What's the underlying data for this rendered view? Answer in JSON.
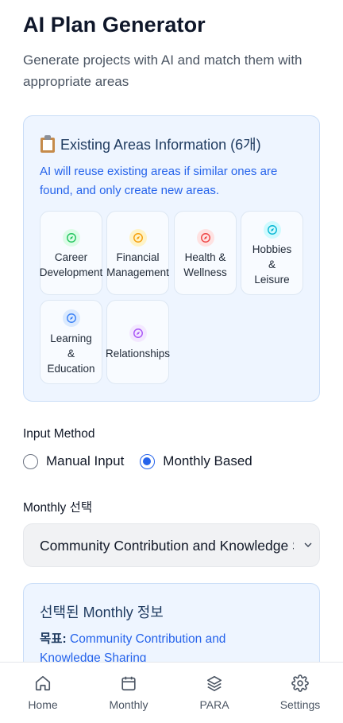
{
  "header": {
    "title": "AI Plan Generator",
    "subtitle": "Generate projects with AI and match them with appropriate areas"
  },
  "areas_card": {
    "title": "Existing Areas Information (6개)",
    "description": "AI will reuse existing areas if similar ones are found, and only create new areas.",
    "icon": "clipboard-icon",
    "areas": [
      {
        "line1": "Career",
        "line2": "Development",
        "line3": "",
        "icon": "compass-icon",
        "color": "#22c55e",
        "bg": "#dcfce7"
      },
      {
        "line1": "Financial",
        "line2": "Management",
        "line3": "",
        "icon": "compass-icon",
        "color": "#f59e0b",
        "bg": "#fef3c7"
      },
      {
        "line1": "Health &",
        "line2": "Wellness",
        "line3": "",
        "icon": "compass-icon",
        "color": "#ef4444",
        "bg": "#fee2e2"
      },
      {
        "line1": "Hobbies",
        "line2": "&",
        "line3": "Leisure",
        "icon": "compass-icon",
        "color": "#06b6d4",
        "bg": "#cffafe"
      },
      {
        "line1": "Learning",
        "line2": "&",
        "line3": "Education",
        "icon": "compass-icon",
        "color": "#3b82f6",
        "bg": "#dbeafe"
      },
      {
        "line1": "Relationships",
        "line2": "",
        "line3": "",
        "icon": "compass-icon",
        "color": "#a855f7",
        "bg": "#f3e8ff"
      }
    ]
  },
  "input_method": {
    "label": "Input Method",
    "options": [
      {
        "label": "Manual Input",
        "selected": false
      },
      {
        "label": "Monthly Based",
        "selected": true
      }
    ]
  },
  "monthly_select": {
    "label": "Monthly 선택",
    "value": "Community Contribution and Knowledge Sharing"
  },
  "selected_monthly": {
    "title": "선택된 Monthly 정보",
    "goal_label": "목표:",
    "goal_value": "Community Contribution and Knowledge Sharing"
  },
  "bottom_nav": [
    {
      "label": "Home",
      "icon": "home-icon"
    },
    {
      "label": "Monthly",
      "icon": "calendar-icon"
    },
    {
      "label": "PARA",
      "icon": "layers-icon"
    },
    {
      "label": "Settings",
      "icon": "gear-icon"
    }
  ],
  "colors": {
    "accent": "#2563eb",
    "card_bg": "#eef5ff",
    "card_border": "#c9ddf7"
  }
}
